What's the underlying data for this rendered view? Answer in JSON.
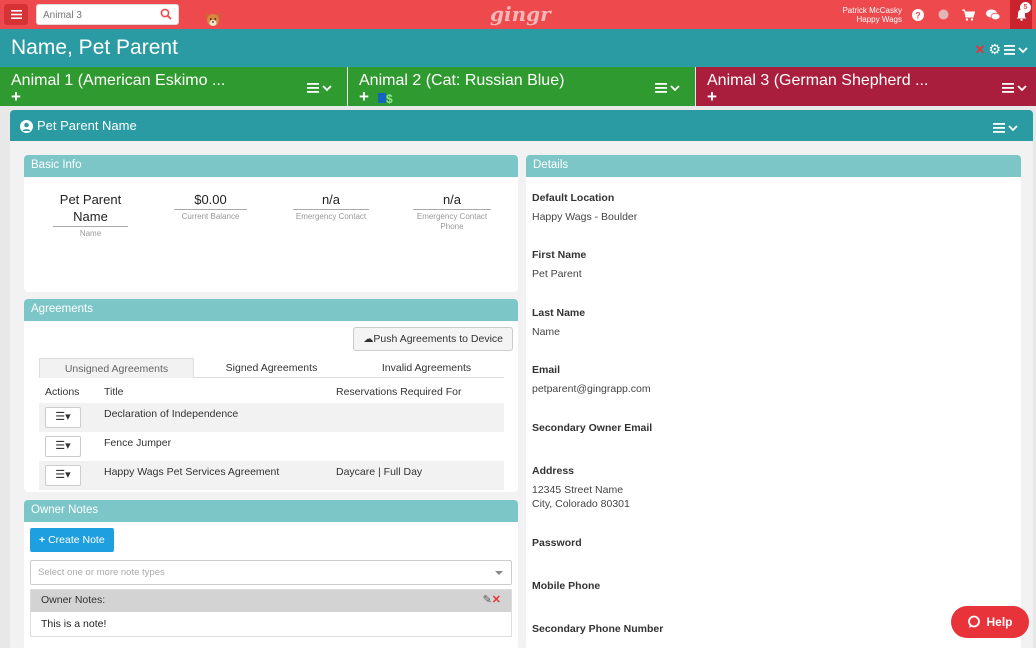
{
  "topbar": {
    "search_placeholder": "Animal 3",
    "logo": "gingr",
    "user_name": "Patrick McCasky",
    "user_company": "Happy Wags",
    "notification_count": "5",
    "icons": [
      "help-icon",
      "status-icon",
      "cart-icon",
      "chat-icon",
      "bell-icon"
    ]
  },
  "titlebar": {
    "title": "Name, Pet Parent"
  },
  "animal_tabs": [
    {
      "label": "Animal 1 (American Eskimo ...",
      "color": "#2f9a2f"
    },
    {
      "label": "Animal 2 (Cat: Russian Blue)",
      "color": "#2f9a2f"
    },
    {
      "label": "Animal 3 (German Shepherd ...",
      "color": "#a91e3c"
    }
  ],
  "panel": {
    "title": "Pet Parent Name"
  },
  "basic_info": {
    "heading": "Basic Info",
    "name_value": "Pet Parent Name",
    "name_label": "Name",
    "balance_value": "$0.00",
    "balance_label": "Current Balance",
    "emergency_value": "n/a",
    "emergency_label": "Emergency Contact",
    "emergency_phone_value": "n/a",
    "emergency_phone_label": "Emergency Contact Phone"
  },
  "agreements": {
    "heading": "Agreements",
    "push_button": "Push Agreements to Device",
    "tabs": [
      "Unsigned Agreements",
      "Signed Agreements",
      "Invalid Agreements"
    ],
    "columns": [
      "Actions",
      "Title",
      "Reservations Required For"
    ],
    "rows": [
      {
        "title": "Declaration of Independence",
        "required": ""
      },
      {
        "title": "Fence Jumper",
        "required": ""
      },
      {
        "title": "Happy Wags Pet Services Agreement",
        "required": "Daycare | Full Day"
      }
    ]
  },
  "owner_notes": {
    "heading": "Owner Notes",
    "create_button": "Create Note",
    "select_placeholder": "Select one or more note types",
    "note_header": "Owner Notes:",
    "note_text": "This is a note!"
  },
  "details": {
    "heading": "Details",
    "fields": [
      {
        "label": "Default Location",
        "value": "Happy Wags - Boulder"
      },
      {
        "label": "First Name",
        "value": "Pet Parent"
      },
      {
        "label": "Last Name",
        "value": "Name"
      },
      {
        "label": "Email",
        "value": "petparent@gingrapp.com"
      },
      {
        "label": "Secondary Owner Email",
        "value": ""
      },
      {
        "label": "Address",
        "value": "12345 Street Name",
        "value2": "City, Colorado 80301"
      },
      {
        "label": "Password",
        "value": ""
      },
      {
        "label": "Mobile Phone",
        "value": ""
      },
      {
        "label": "Secondary Phone Number",
        "value": ""
      }
    ]
  },
  "help_button": "Help"
}
